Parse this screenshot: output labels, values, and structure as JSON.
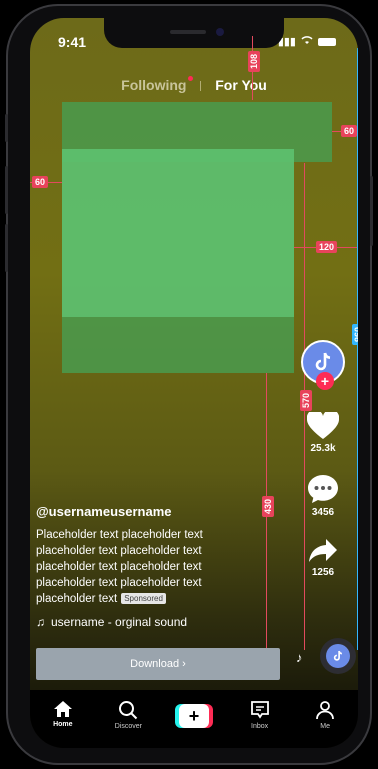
{
  "status": {
    "time": "9:41"
  },
  "tabs": {
    "following": "Following",
    "for_you": "For You"
  },
  "measurements": {
    "top": "108",
    "right_60": "60",
    "left_60": "60",
    "right_120": "120",
    "v_570": "570",
    "v_430": "430",
    "v_960": "960"
  },
  "actions": {
    "likes": "25.3k",
    "comments": "3456",
    "shares": "1256"
  },
  "caption": {
    "username": "@usernameusername",
    "line1": "Placeholder text placeholder text",
    "line2": "placeholder text placeholder text",
    "line3": "placeholder text placeholder text",
    "line4": "placeholder text  placeholder text",
    "line5": "placeholder text",
    "sponsored": "Sponsored",
    "sound": "username - orginal sound"
  },
  "cta": {
    "download": "Download  ›"
  },
  "nav": {
    "home": "Home",
    "discover": "Discover",
    "inbox": "Inbox",
    "me": "Me"
  },
  "colors": {
    "accent": "#fe2c55",
    "cyan": "#25f4ee",
    "measure_red": "#e8435b",
    "measure_blue": "#33b7ff"
  }
}
